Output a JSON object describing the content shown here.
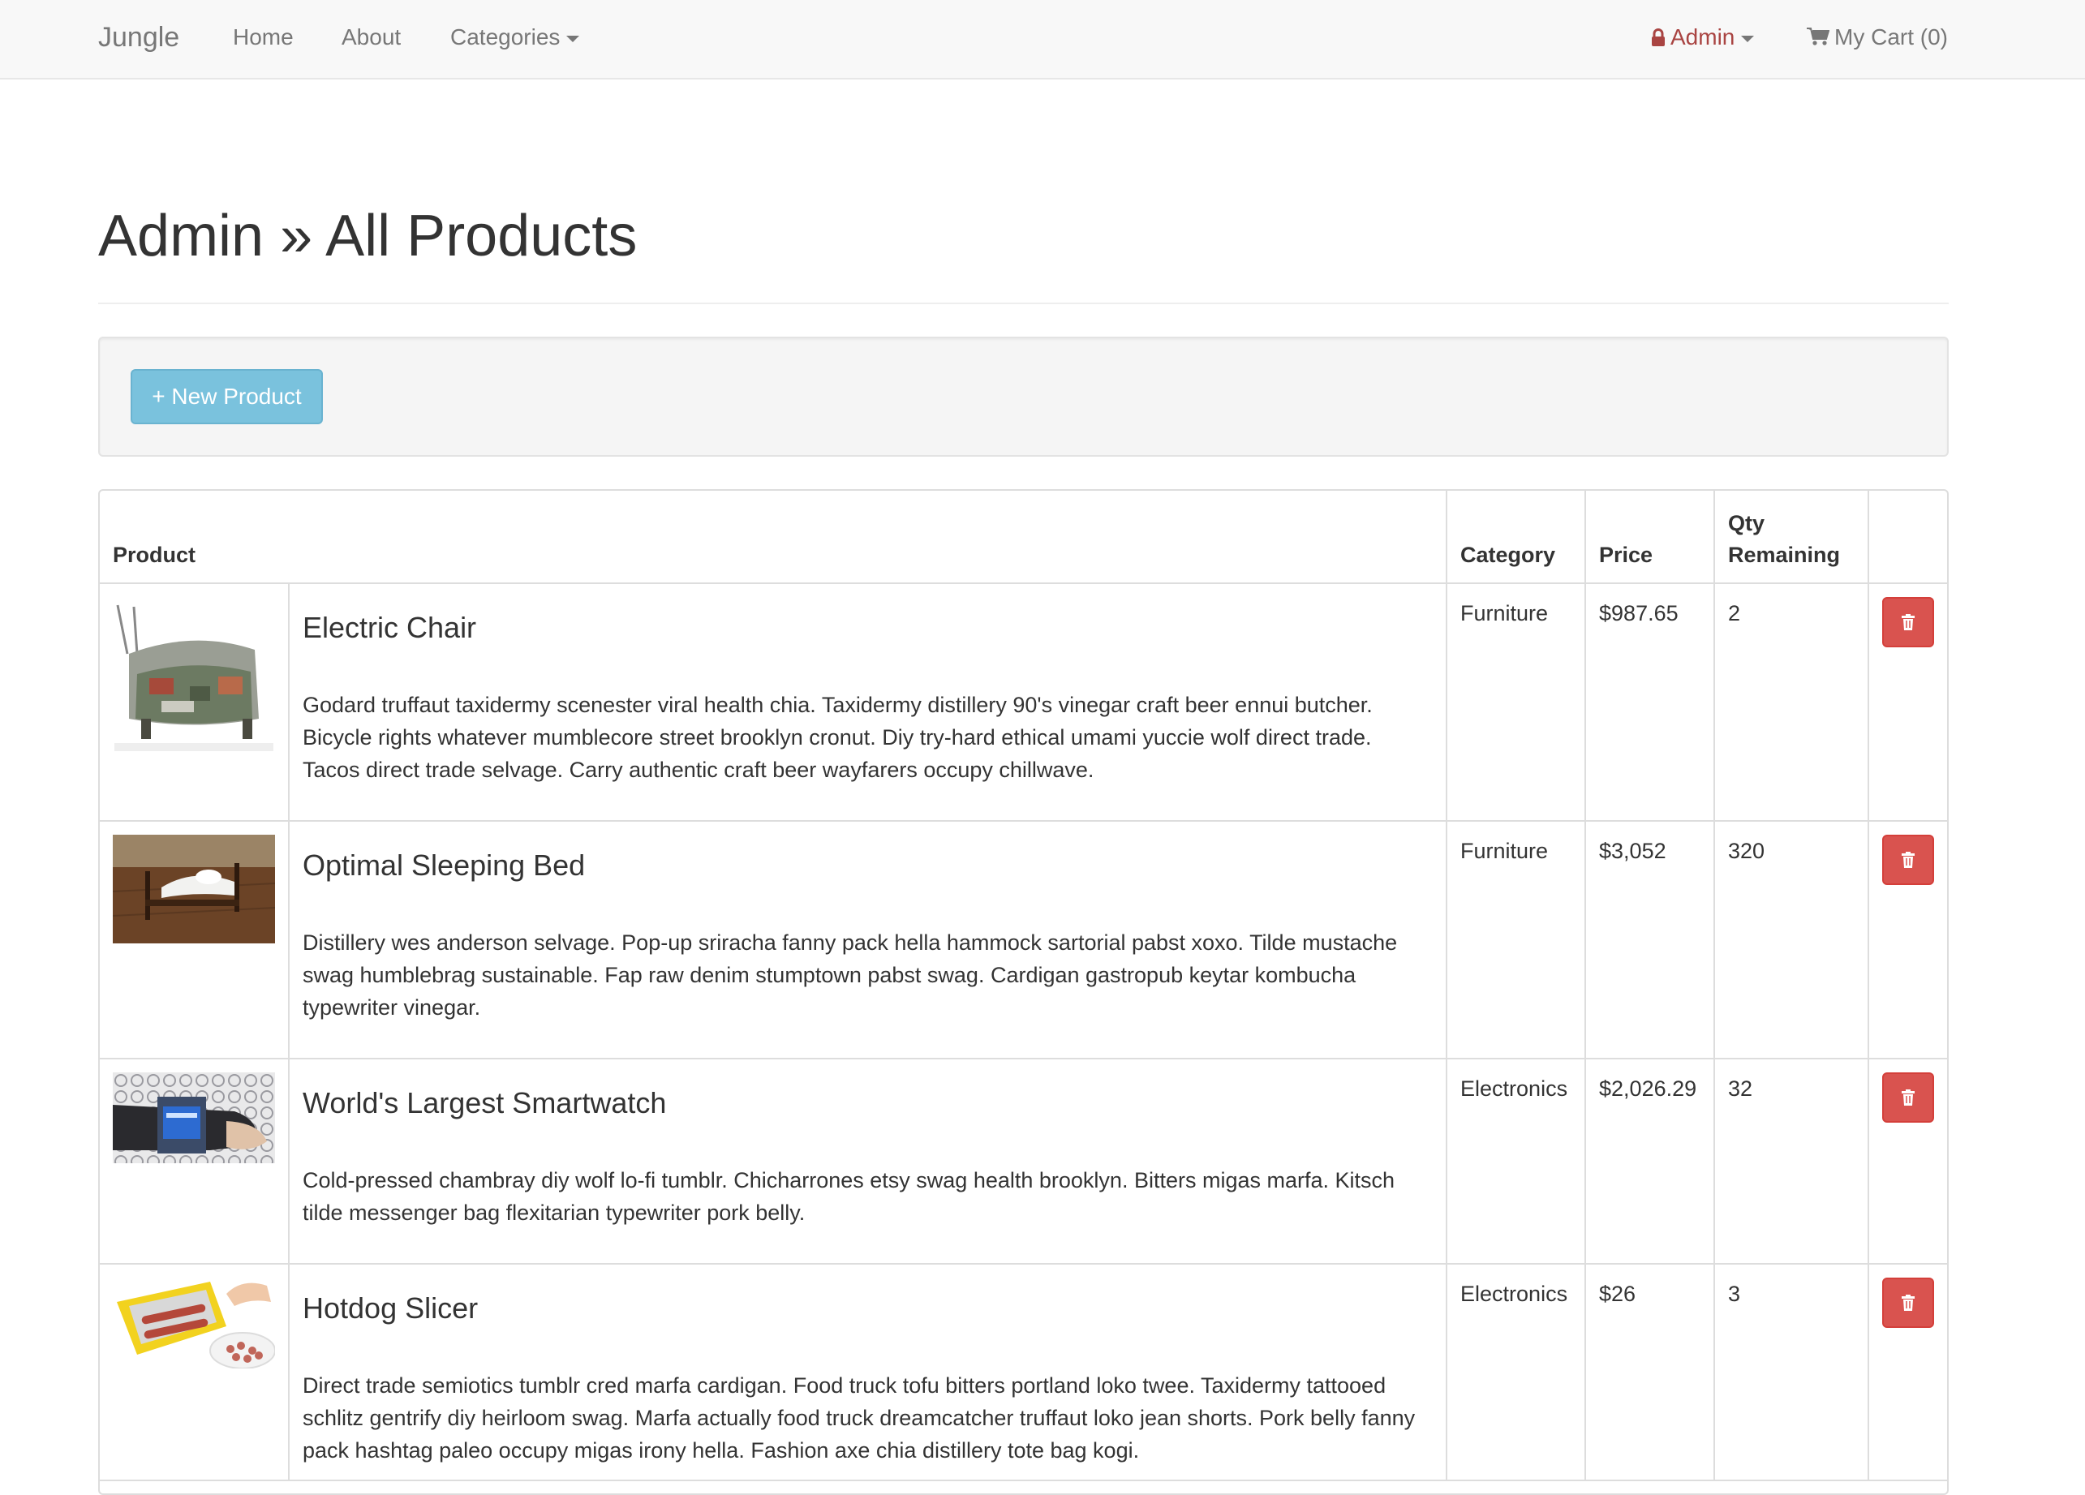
{
  "navbar": {
    "brand": "Jungle",
    "links": [
      {
        "label": "Home"
      },
      {
        "label": "About"
      },
      {
        "label": "Categories"
      }
    ],
    "admin_label": "Admin",
    "cart_label": "My Cart (0)",
    "colors": {
      "background": "#f8f8f8",
      "link": "#777777",
      "admin": "#a94442"
    }
  },
  "page": {
    "title": "Admin » All Products"
  },
  "toolbar": {
    "new_product_label": "+ New Product",
    "button_color": "#7ac2dd"
  },
  "table": {
    "headers": {
      "product": "Product",
      "category": "Category",
      "price": "Price",
      "qty": "Qty Remaining"
    },
    "rows": [
      {
        "image": "electric-chair-image",
        "name": "Electric Chair",
        "description": "Godard truffaut taxidermy scenester viral health chia. Taxidermy distillery 90's vinegar craft beer ennui butcher. Bicycle rights whatever mumblecore street brooklyn cronut. Diy try-hard ethical umami yuccie wolf direct trade. Tacos direct trade selvage. Carry authentic craft beer wayfarers occupy chillwave.",
        "category": "Furniture",
        "price": "$987.65",
        "qty": "2"
      },
      {
        "image": "sleeping-bed-image",
        "name": "Optimal Sleeping Bed",
        "description": "Distillery wes anderson selvage. Pop-up sriracha fanny pack hella hammock sartorial pabst xoxo. Tilde mustache swag humblebrag sustainable. Fap raw denim stumptown pabst swag. Cardigan gastropub keytar kombucha typewriter vinegar.",
        "category": "Furniture",
        "price": "$3,052",
        "qty": "320"
      },
      {
        "image": "smartwatch-image",
        "name": "World's Largest Smartwatch",
        "description": "Cold-pressed chambray diy wolf lo-fi tumblr. Chicharrones etsy swag health brooklyn. Bitters migas marfa. Kitsch tilde messenger bag flexitarian typewriter pork belly.",
        "category": "Electronics",
        "price": "$2,026.29",
        "qty": "32"
      },
      {
        "image": "hotdog-slicer-image",
        "name": "Hotdog Slicer",
        "description": "Direct trade semiotics tumblr cred marfa cardigan. Food truck tofu bitters portland loko twee. Taxidermy tattooed schlitz gentrify diy heirloom swag. Marfa actually food truck dreamcatcher truffaut loko jean shorts. Pork belly fanny pack hashtag paleo occupy migas irony hella. Fashion axe chia distillery tote bag kogi.",
        "category": "Electronics",
        "price": "$26",
        "qty": "3"
      }
    ],
    "delete_icon": "trash-icon",
    "delete_color": "#d9534f"
  }
}
